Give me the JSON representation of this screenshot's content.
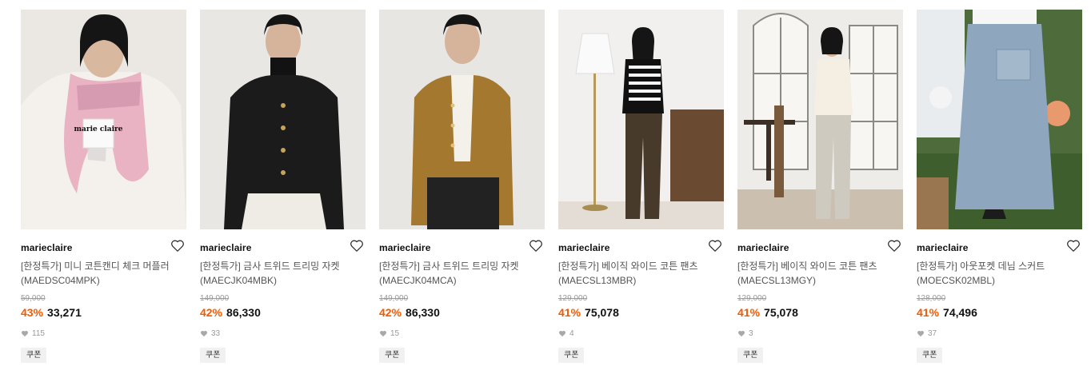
{
  "colors": {
    "discount": "#f05a00",
    "text": "#111111",
    "muted": "#999999",
    "coupon_bg": "#f1f1f1"
  },
  "products": [
    {
      "brand": "marieclaire",
      "title": "[한정특가] 미니 코튼캔디 체크 머플러",
      "code": "(MAEDSC04MPK)",
      "original_price": "59,000",
      "discount": "43%",
      "price": "33,271",
      "likes": "115",
      "coupon": "쿠폰",
      "icon": "heart-icon",
      "label_text": "marie claire"
    },
    {
      "brand": "marieclaire",
      "title": "[한정특가] 금사 트위드 트리밍 자켓",
      "code": "(MAECJK04MBK)",
      "original_price": "149,000",
      "discount": "42%",
      "price": "86,330",
      "likes": "33",
      "coupon": "쿠폰",
      "icon": "heart-icon"
    },
    {
      "brand": "marieclaire",
      "title": "[한정특가] 금사 트위드 트리밍 자켓",
      "code": "(MAECJK04MCA)",
      "original_price": "149,000",
      "discount": "42%",
      "price": "86,330",
      "likes": "15",
      "coupon": "쿠폰",
      "icon": "heart-icon"
    },
    {
      "brand": "marieclaire",
      "title": "[한정특가] 베이직 와이드 코튼 팬츠",
      "code": "(MAECSL13MBR)",
      "original_price": "129,000",
      "discount": "41%",
      "price": "75,078",
      "likes": "4",
      "coupon": "쿠폰",
      "icon": "heart-icon"
    },
    {
      "brand": "marieclaire",
      "title": "[한정특가] 베이직 와이드 코튼 팬츠",
      "code": "(MAECSL13MGY)",
      "original_price": "129,000",
      "discount": "41%",
      "price": "75,078",
      "likes": "3",
      "coupon": "쿠폰",
      "icon": "heart-icon"
    },
    {
      "brand": "marieclaire",
      "title": "[한정특가] 아웃포켓 데님 스커트",
      "code": "(MOECSK02MBL)",
      "original_price": "128,000",
      "discount": "41%",
      "price": "74,496",
      "likes": "37",
      "coupon": "쿠폰",
      "icon": "heart-icon"
    }
  ]
}
